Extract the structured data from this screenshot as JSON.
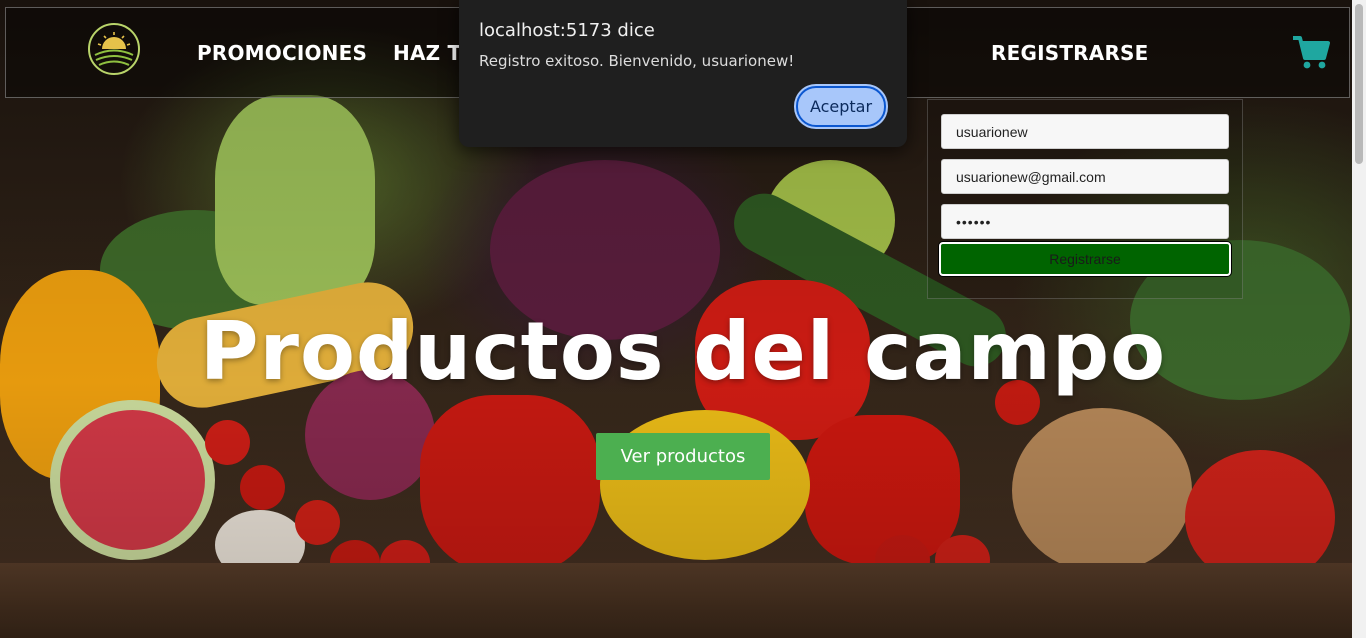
{
  "navbar": {
    "links": [
      "PROMOCIONES",
      "HAZ TU",
      "REGISTRARSE"
    ]
  },
  "hero": {
    "title": "Productos del campo",
    "button_label": "Ver productos"
  },
  "register_form": {
    "username_value": "usuarionew",
    "email_value": "usuarionew@gmail.com",
    "password_value": "••••••",
    "submit_label": "Registrarse"
  },
  "dialog": {
    "title": "localhost:5173 dice",
    "message": "Registro exitoso. Bienvenido, usuarionew!",
    "button_label": "Aceptar"
  },
  "colors": {
    "register_button": "#006400",
    "hero_button": "#4caf50",
    "cart_icon": "#1fa7a0",
    "dialog_button": "#a8c7fa"
  },
  "icons": [
    "logo-sun-field-icon",
    "cart-icon"
  ]
}
